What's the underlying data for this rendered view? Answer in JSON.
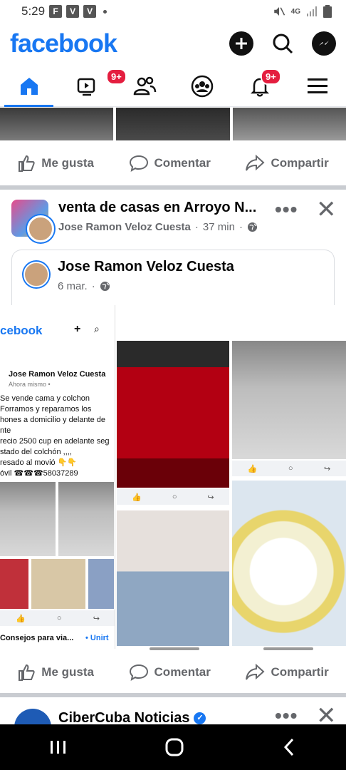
{
  "status": {
    "time": "5:29",
    "network": "4G",
    "notif_icons": [
      "F",
      "V",
      "V"
    ]
  },
  "header": {
    "logo": "facebook",
    "icons": [
      "add-icon",
      "search-icon",
      "messenger-icon"
    ]
  },
  "tabs": [
    {
      "name": "home",
      "badge": ""
    },
    {
      "name": "video",
      "badge": "9+"
    },
    {
      "name": "friends",
      "badge": ""
    },
    {
      "name": "groups",
      "badge": ""
    },
    {
      "name": "notifications",
      "badge": "9+"
    },
    {
      "name": "menu",
      "badge": ""
    }
  ],
  "actions": {
    "like": "Me gusta",
    "comment": "Comentar",
    "share": "Compartir"
  },
  "post": {
    "title": "venta de casas en Arroyo N...",
    "author": "Jose Ramon Veloz Cuesta",
    "time": "37 min",
    "dots": "•••",
    "close": "✕"
  },
  "shared": {
    "name": "Jose Ramon Veloz Cuesta",
    "date": "6 mar."
  },
  "screenshot_mini": {
    "logo": "cebook",
    "author": "Jose Ramon Veloz Cuesta",
    "sub": "Ahora mismo •",
    "line1": "Se  vende cama y colchon",
    "line2": "Forramos y reparamos los",
    "line3": "hones a domicilio y delante de",
    "line4": "nte",
    "line5": "recio 2500 cup en adelante seg",
    "line6": "stado del colchón ,,,,",
    "line7": "resado al movió 👇👇",
    "line8": "óvil ☎☎☎58037289",
    "footer": "Consejos para via...",
    "footer2": "• Unirt"
  },
  "post2": {
    "name": "CiberCuba Noticias"
  },
  "colors": {
    "brand": "#1877f2",
    "badge": "#e41e3f"
  }
}
